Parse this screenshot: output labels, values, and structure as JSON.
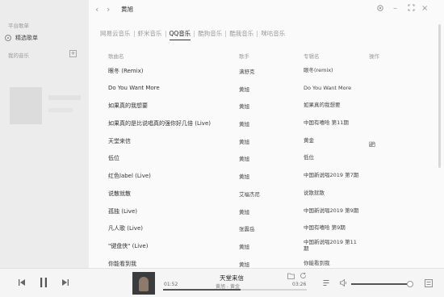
{
  "sidebar": {
    "section_platform": "平台歌单",
    "selected_item": "精选歌单",
    "section_my_music": "我的音乐"
  },
  "topbar": {
    "search_value": "黄旭"
  },
  "tabs": [
    {
      "label": "网易云音乐",
      "active": false
    },
    {
      "label": "虾米音乐",
      "active": false
    },
    {
      "label": "QQ音乐",
      "active": true
    },
    {
      "label": "酷狗音乐",
      "active": false
    },
    {
      "label": "酷我音乐",
      "active": false
    },
    {
      "label": "咪咕音乐",
      "active": false
    }
  ],
  "table": {
    "headers": {
      "name": "歌曲名",
      "artist": "歌手",
      "album": "专辑名",
      "ops": "操作"
    },
    "rows": [
      {
        "name": "眼冬 (Remix)",
        "artist": "满舒克",
        "album": "眼冬(remix)"
      },
      {
        "name": "Do You Want More",
        "artist": "黄旭",
        "album": "Do You Want More"
      },
      {
        "name": "如果真的我想要",
        "artist": "黄旭",
        "album": "如果真的我想要"
      },
      {
        "name": "如果真的是比说唱真的强你好几倍 (Live)",
        "artist": "黄旭",
        "album": "中国有嘻哈 第11期"
      },
      {
        "name": "天堂来信",
        "artist": "黄旭",
        "album": "黄金"
      },
      {
        "name": "低位",
        "artist": "黄旭",
        "album": "低位"
      },
      {
        "name": "红色label (Live)",
        "artist": "黄旭",
        "album": "中国新说唱2019 第7期"
      },
      {
        "name": "说散就散",
        "artist": "艾福杰尼",
        "album": "说散就散"
      },
      {
        "name": "孤独 (Live)",
        "artist": "黄旭",
        "album": "中国新说唱2019 第9期"
      },
      {
        "name": "凡人歌 (Live)",
        "artist": "张震岳",
        "album": "中国有嘻哈 第9期"
      },
      {
        "name": "\"键盘侠\" (Live)",
        "artist": "黄旭",
        "album": "中国新说唱2019 第11期"
      },
      {
        "name": "你能看到我",
        "artist": "黄旭",
        "album": "你能看到我"
      }
    ]
  },
  "player": {
    "song_title": "天堂来信",
    "song_meta": "黄旭 - 黄金",
    "current_time": "01:52",
    "total_time": "03:26",
    "progress_fraction": 0.54,
    "volume_fraction": 0.94
  }
}
